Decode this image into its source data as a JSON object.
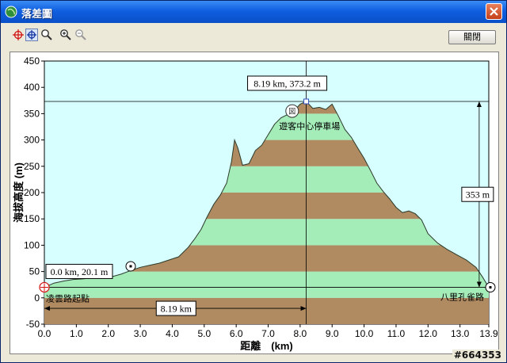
{
  "window": {
    "title": "落差圖"
  },
  "toolbar": {
    "icons": [
      "crosshair-icon",
      "crosshair-box-icon",
      "magnifier-icon",
      "zoom-in-icon",
      "zoom-out-icon"
    ],
    "close_label": "關閉"
  },
  "watermark": "#664353",
  "chart_data": {
    "type": "area",
    "xlabel": "距離　(km)",
    "ylabel": "海拔高度 (m)",
    "xlim": [
      0.0,
      13.9
    ],
    "ylim": [
      -50,
      450
    ],
    "x_ticks": [
      "0.0",
      "1.0",
      "2.0",
      "3.0",
      "4.0",
      "5.0",
      "6.0",
      "7.0",
      "8.0",
      "9.0",
      "10.0",
      "11.0",
      "12.0",
      "13.0",
      "13.9"
    ],
    "y_ticks": [
      "-50",
      "0",
      "50",
      "100",
      "150",
      "200",
      "250",
      "300",
      "350",
      "400",
      "450"
    ],
    "series": [
      {
        "x": [
          0.0,
          0.3,
          0.6,
          0.9,
          1.2,
          1.5,
          1.8,
          2.1,
          2.4,
          2.7,
          3.0,
          3.3,
          3.6,
          3.9,
          4.2,
          4.5,
          4.7,
          4.9,
          5.1,
          5.3,
          5.5,
          5.7,
          5.85,
          5.95,
          6.05,
          6.2,
          6.4,
          6.6,
          6.8,
          7.0,
          7.2,
          7.4,
          7.6,
          7.8,
          8.0,
          8.19,
          8.4,
          8.6,
          8.8,
          9.0,
          9.2,
          9.4,
          9.6,
          9.8,
          10.0,
          10.2,
          10.4,
          10.6,
          10.8,
          11.0,
          11.2,
          11.4,
          11.6,
          11.8,
          12.0,
          12.3,
          12.6,
          12.9,
          13.2,
          13.5,
          13.7,
          13.9
        ],
        "y": [
          20.1,
          28,
          32,
          35,
          36,
          38,
          40,
          40,
          45,
          52,
          58,
          62,
          66,
          72,
          78,
          96,
          112,
          130,
          155,
          178,
          195,
          218,
          258,
          300,
          285,
          252,
          255,
          280,
          290,
          310,
          330,
          342,
          348,
          355,
          368,
          373.2,
          360,
          362,
          358,
          368,
          345,
          320,
          305,
          285,
          265,
          242,
          218,
          202,
          188,
          172,
          162,
          165,
          160,
          148,
          122,
          104,
          92,
          82,
          72,
          58,
          40,
          20
        ]
      }
    ],
    "bands": [
      0,
      50,
      100,
      150,
      200,
      250,
      300,
      350,
      400
    ],
    "points": [
      {
        "label": "凌雲路起點",
        "x": 0.0,
        "y": 20.1
      },
      {
        "label": "遊客中心停車場",
        "x": 7.75,
        "y": 355
      },
      {
        "label": "八里孔雀路",
        "x": 13.9,
        "y": 20
      }
    ],
    "markers": [
      {
        "x": 2.7,
        "y": 60
      }
    ],
    "cursor": {
      "x": 8.19,
      "y": 373.2,
      "readout": "8.19 km, 373.2 m"
    },
    "start_readout": "0.0 km, 20.1 m",
    "distance_readout": "8.19 km",
    "height_readout": "353 m"
  }
}
